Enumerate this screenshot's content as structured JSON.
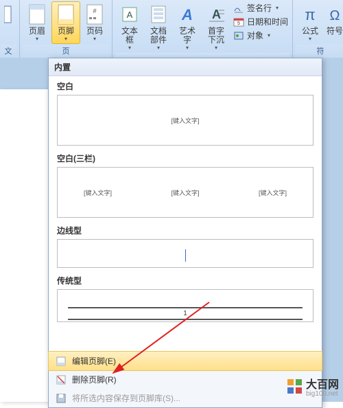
{
  "ribbon": {
    "header_footer_group": {
      "label": "页",
      "header": "页眉",
      "footer": "页脚",
      "pagenum": "页码"
    },
    "text_group": {
      "textbox": "文本框",
      "quickparts": "文档部件",
      "wordart": "艺术字",
      "dropcap": "首字下沉",
      "signature": "签名行",
      "datetime": "日期和时间",
      "object": "对象"
    },
    "symbols_group": {
      "label": "符",
      "equation": "公式",
      "symbol": "符号"
    },
    "edge_label": "文"
  },
  "dropdown": {
    "header": "内置",
    "items": [
      {
        "title": "空白",
        "kind": "one",
        "placeholder": "[键入文字]"
      },
      {
        "title": "空白(三栏)",
        "kind": "three",
        "placeholder": "[键入文字]"
      },
      {
        "title": "边线型",
        "kind": "thin"
      },
      {
        "title": "传统型",
        "kind": "trad",
        "pagenum": "1"
      }
    ],
    "commands": {
      "edit": "编辑页脚(E)",
      "remove": "删除页脚(R)",
      "save": "将所选内容保存到页脚库(S)..."
    }
  },
  "watermark": {
    "text": "大百网",
    "url": "big100.net"
  }
}
